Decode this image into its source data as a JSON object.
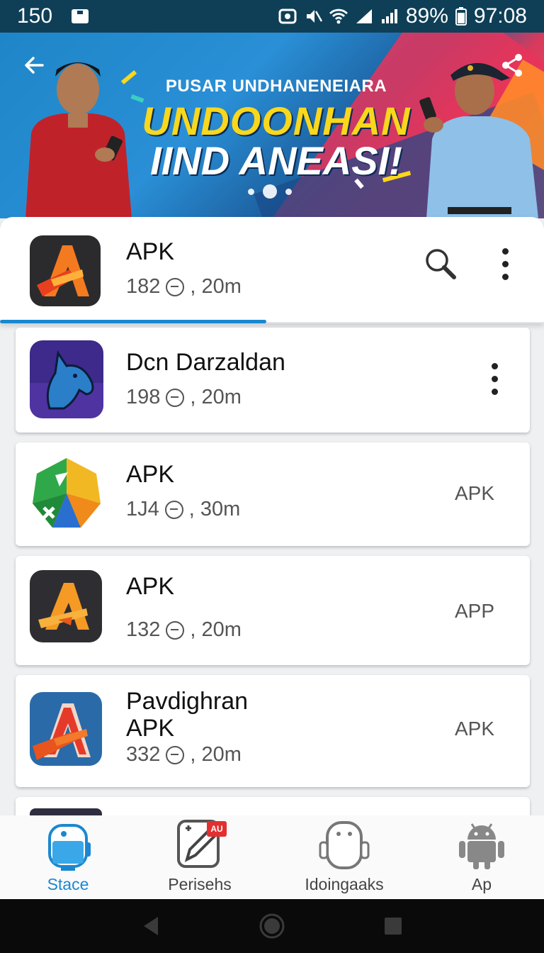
{
  "status_bar": {
    "left_text": "150",
    "battery": "89%",
    "time": "97:08"
  },
  "banner": {
    "subtitle": "PUSAR UNDHANENEIARA",
    "title_line1": "UNDOONHAN",
    "title_line2": "IIND ANEASI!",
    "slide_count": 3,
    "active_slide": 2
  },
  "top_app": {
    "title": "APK",
    "meta_count": "182",
    "meta_time": ", 20m",
    "download_progress": 0.49
  },
  "apps": [
    {
      "title": "Dcn Darzaldan",
      "meta_count": "198",
      "meta_time": ", 20m",
      "side_label": ""
    },
    {
      "title": "APK",
      "meta_count": "1J4",
      "meta_time": ", 30m",
      "side_label": "APK"
    },
    {
      "title": "APK",
      "meta_count": "132",
      "meta_time": ", 20m",
      "side_label": "APP"
    },
    {
      "title": "Pavdighran",
      "title2": "APK",
      "meta_count": "332",
      "meta_time": ", 20m",
      "side_label": "APK"
    }
  ],
  "bottom_nav": [
    {
      "label": "Stace",
      "icon": "store-bot-icon",
      "active": true
    },
    {
      "label": "Perisehs",
      "icon": "edit-icon",
      "badge": "AU"
    },
    {
      "label": "Idoingaaks",
      "icon": "robot-icon"
    },
    {
      "label": "Ap",
      "icon": "android-icon"
    }
  ],
  "colors": {
    "accent": "#1a88d0",
    "status_bar": "#0f3f57",
    "badge": "#e23030"
  }
}
